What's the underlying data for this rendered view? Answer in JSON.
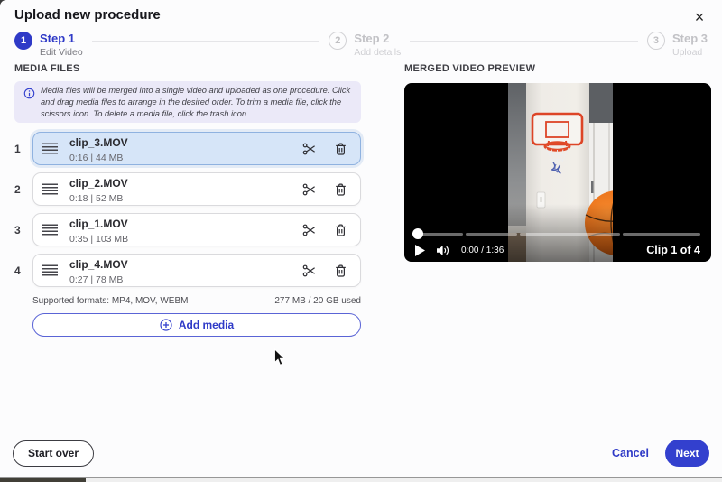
{
  "title": "Upload new procedure",
  "close_glyph": "×",
  "steps": [
    {
      "num": "1",
      "label": "Step 1",
      "sub": "Edit Video"
    },
    {
      "num": "2",
      "label": "Step 2",
      "sub": "Add details"
    },
    {
      "num": "3",
      "label": "Step 3",
      "sub": "Upload"
    }
  ],
  "media": {
    "heading": "MEDIA FILES",
    "info": "Media files will be merged into a single video and uploaded as one procedure. Click and drag media files to arrange in the desired order. To trim a media file, click the scissors icon. To delete a media file, click the trash icon.",
    "items": [
      {
        "num": "1",
        "name": "clip_3.MOV",
        "meta": "0:16 | 44 MB"
      },
      {
        "num": "2",
        "name": "clip_2.MOV",
        "meta": "0:18 | 52 MB"
      },
      {
        "num": "3",
        "name": "clip_1.MOV",
        "meta": "0:35 | 103 MB"
      },
      {
        "num": "4",
        "name": "clip_4.MOV",
        "meta": "0:27 | 78 MB"
      }
    ],
    "formats": "Supported formats: MP4, MOV, WEBM",
    "usage": "277 MB / 20 GB used",
    "add_label": "Add media"
  },
  "preview": {
    "heading": "MERGED VIDEO PREVIEW",
    "time": "0:00 / 1:36",
    "clip": "Clip 1 of 4",
    "segments_pct": [
      16.7,
      18.7,
      36.5,
      28.1
    ]
  },
  "actions": {
    "start_over": "Start over",
    "cancel": "Cancel",
    "next": "Next"
  },
  "colors": {
    "accent": "#3340CE",
    "selected_bg": "#D6E5F8",
    "selected_border": "#8FB2E0",
    "banner_bg": "#EBE9F8"
  }
}
